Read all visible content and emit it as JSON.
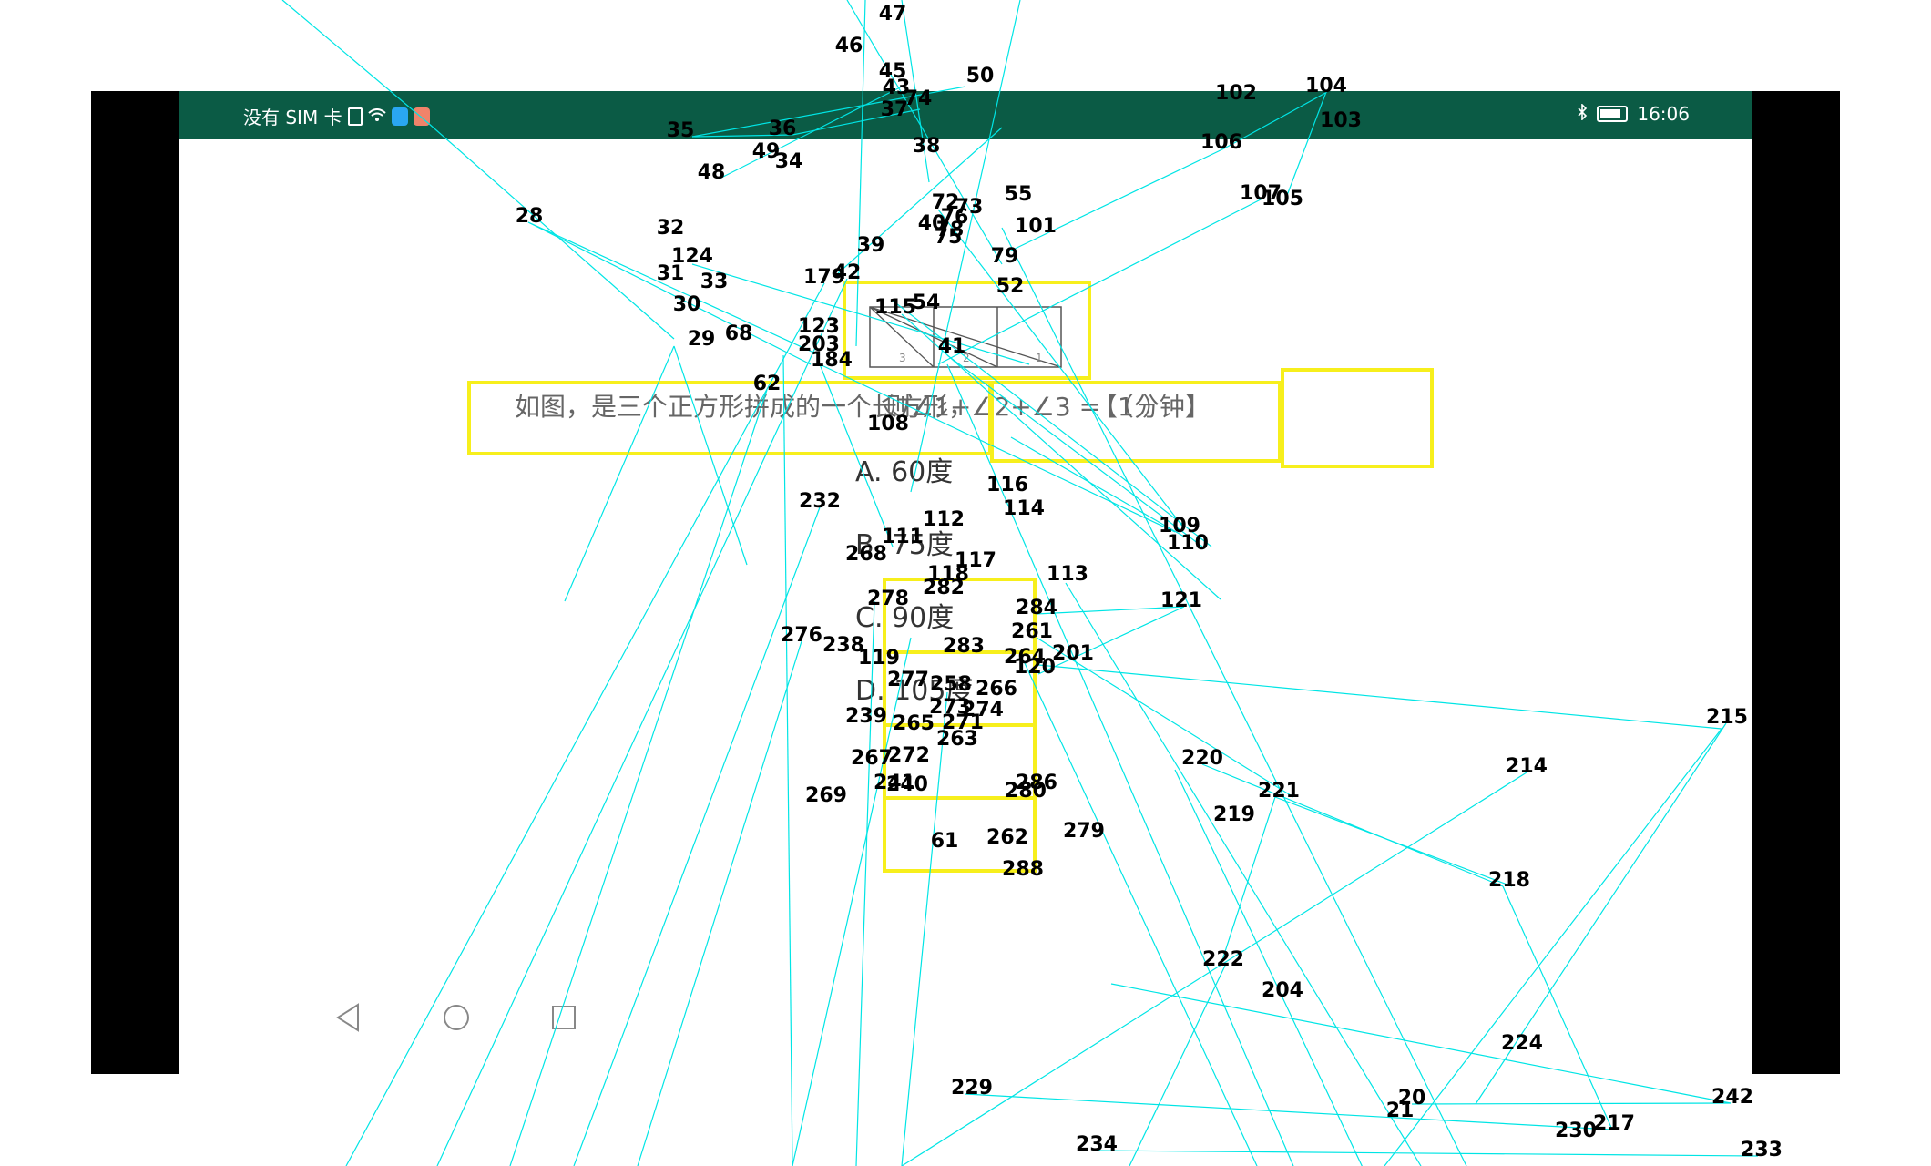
{
  "status_bar": {
    "carrier": "没有 SIM 卡",
    "time": "16:06",
    "bluetooth_icon": "bluetooth-icon",
    "battery_icon": "battery-icon",
    "wifi_icon": "wifi-icon"
  },
  "question": {
    "part1": "如图，是三个正方形拼成的一个长方形，",
    "part2": "则∠1+∠2+∠3 = （ ）",
    "part3": "【1分钟】"
  },
  "options": [
    {
      "label": "A. 60度"
    },
    {
      "label": "B. 75度"
    },
    {
      "label": "C. 90度"
    },
    {
      "label": "D. 105度"
    }
  ],
  "figure_labels": [
    "1",
    "2",
    "3"
  ],
  "nav": {
    "back_icon": "back-triangle-icon",
    "home_icon": "home-circle-icon",
    "recents_icon": "recents-square-icon"
  },
  "overlay_labels": [
    "47",
    "46",
    "45",
    "43",
    "37",
    "74",
    "50",
    "35",
    "36",
    "49",
    "34",
    "48",
    "38",
    "102",
    "104",
    "103",
    "106",
    "107",
    "105",
    "28",
    "32",
    "72",
    "76",
    "73",
    "55",
    "40",
    "78",
    "75",
    "101",
    "124",
    "39",
    "79",
    "31",
    "33",
    "179",
    "42",
    "52",
    "30",
    "115",
    "54",
    "123",
    "29",
    "68",
    "203",
    "184",
    "41",
    "62",
    "108",
    "116",
    "114",
    "232",
    "112",
    "109",
    "111",
    "110",
    "268",
    "117",
    "118",
    "113",
    "282",
    "278",
    "284",
    "121",
    "261",
    "276",
    "238",
    "283",
    "264",
    "201",
    "119",
    "120",
    "277",
    "258",
    "266",
    "273",
    "274",
    "239",
    "265",
    "271",
    "215",
    "263",
    "214",
    "267",
    "272",
    "220",
    "241",
    "240",
    "286",
    "280",
    "221",
    "269",
    "219",
    "61",
    "262",
    "279",
    "218",
    "288",
    "222",
    "204",
    "224",
    "229",
    "20",
    "21",
    "242",
    "217",
    "230",
    "234",
    "233"
  ],
  "colors": {
    "status_bar": "#0b5b45",
    "annotation_box": "#f7ef1c",
    "overlay_line": "#00e5e5",
    "question_text": "#666666"
  }
}
